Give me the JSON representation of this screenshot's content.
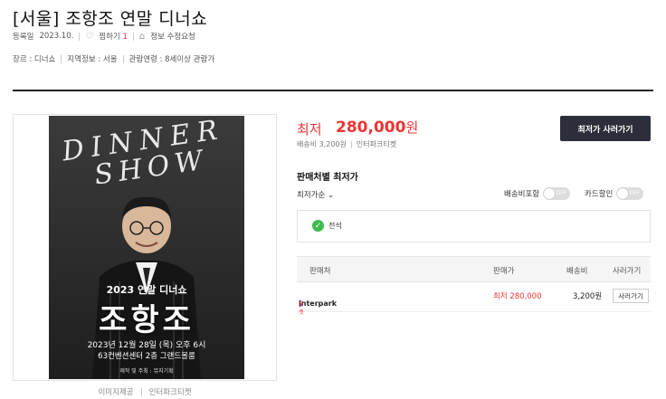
{
  "product": {
    "title": "[서울] 조항조 연말 디너쇼",
    "reg_label": "등록일",
    "reg_date": "2023.10.",
    "like_label": "찜하기",
    "like_count": "1",
    "report_label": "정보 수정요청"
  },
  "info": {
    "genre": "장르 : 디너쇼",
    "region": "지역정보 : 서울",
    "age": "관람연령 : 8세이상 관람가"
  },
  "poster": {
    "top_text_1": "DINNER",
    "top_text_2": "SHOW",
    "title": "2023 연말 디너쇼",
    "name": "조항조",
    "date": "2023년 12월 28일 (목) 오후 6시",
    "venue": "63컨벤션센터 2층 그랜드볼룸",
    "org": "제작 및 주최 : 뮤지기획"
  },
  "credit": {
    "img_provider": "이미지제공",
    "source": "인터파크티켓"
  },
  "price": {
    "label": "최저",
    "value": "280,000",
    "unit": "원",
    "shipping": "배송비 3,200원",
    "seller": "인터파크티켓",
    "buy_button": "최저가 사러가기"
  },
  "sellers": {
    "title": "판매처별 최저가",
    "sort": "최저가순",
    "free_ship": "배송비포함",
    "card_discount": "카드할인",
    "toggle_off": "OFF",
    "filter_all": "전석",
    "columns": [
      "판매처",
      "판매가",
      "배송비",
      "사러가기"
    ],
    "rows": [
      {
        "seller": "interpark",
        "seller_sub": "티켓",
        "price": "최저  280,000",
        "shipping": "3,200원",
        "buy": "사러가기"
      }
    ]
  },
  "colors": {
    "accent_red": "#e33333",
    "button_dark": "#2c2f3b",
    "check_green": "#3fb950"
  },
  "icons": [
    "heart-icon",
    "bell-icon",
    "chevron-down-icon",
    "check-icon"
  ]
}
